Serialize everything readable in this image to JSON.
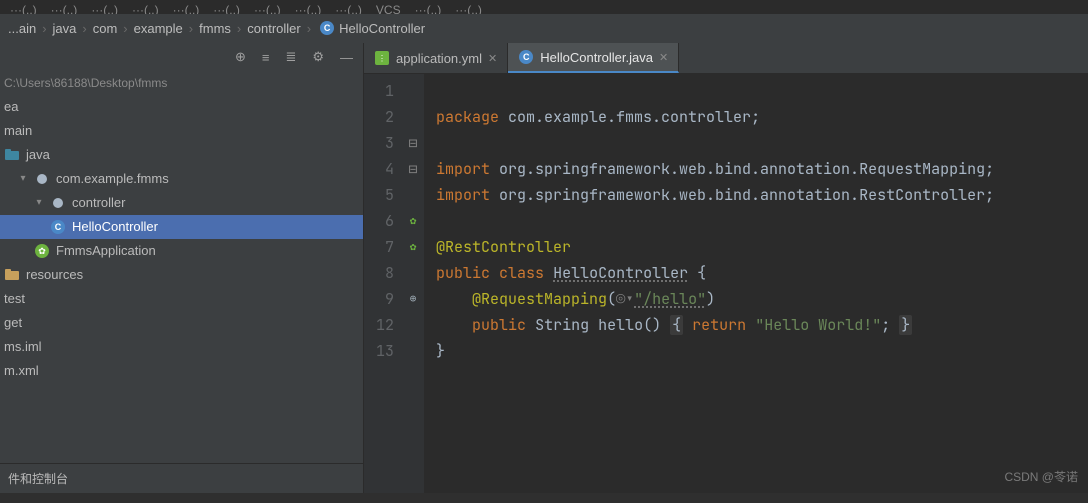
{
  "menu": [
    "···(..)",
    "···(..)",
    "···(..)",
    "···(..)",
    "···(..)",
    "···(..)",
    "···(..)",
    "···(..)",
    "···(..)",
    "VCS",
    "···(..)",
    "···(..)"
  ],
  "breadcrumbs": [
    "...ain",
    "java",
    "com",
    "example",
    "fmms",
    "controller",
    "HelloController"
  ],
  "project_path": "C:\\Users\\86188\\Desktop\\fmms",
  "tree": {
    "ea": "ea",
    "main": "main",
    "java": "java",
    "pkg": "com.example.fmms",
    "controller": "controller",
    "hello": "HelloController",
    "app": "FmmsApplication",
    "resources": "resources",
    "test": "test",
    "get": "get",
    "iml": "ms.iml",
    "xml": "m.xml"
  },
  "tabs": [
    {
      "label": "application.yml",
      "active": false
    },
    {
      "label": "HelloController.java",
      "active": true
    }
  ],
  "code": {
    "line_nums": [
      "1",
      "2",
      "3",
      "4",
      "5",
      "6",
      "7",
      "8",
      "9",
      "12",
      "13"
    ],
    "l1_kw": "package",
    "l1_pkg": "com.example.fmms.controller",
    "l3_kw": "import",
    "l3_pkg": "org.springframework.web.bind.annotation.",
    "l3_cls": "RequestMapping",
    "l4_kw": "import",
    "l4_pkg": "org.springframework.web.bind.annotation.",
    "l4_cls": "RestController",
    "l6_ann": "@RestController",
    "l7_kw1": "public",
    "l7_kw2": "class",
    "l7_cls": "HelloController",
    "l8_ann": "@RequestMapping",
    "l8_path": "\"/hello\"",
    "l9_kw1": "public",
    "l9_type": "String",
    "l9_name": "hello",
    "l9_ret": "return",
    "l9_str": "\"Hello World!\""
  },
  "bottom": "件和控制台",
  "watermark": "CSDN @苓诺"
}
